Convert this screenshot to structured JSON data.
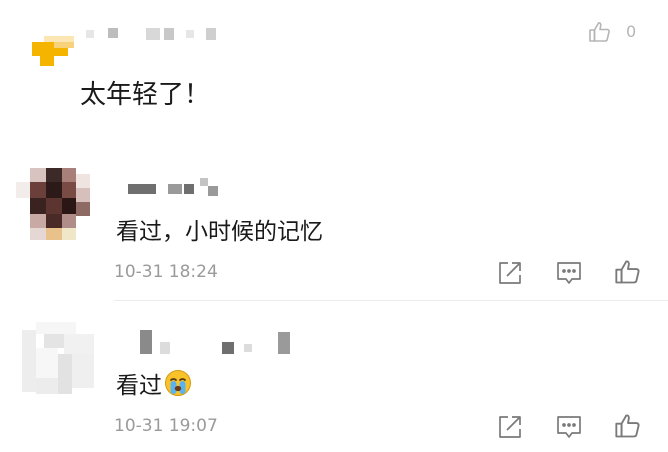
{
  "comments": [
    {
      "text": "太年轻了！",
      "like_count": "0"
    },
    {
      "text": "看过，小时候的记忆",
      "timestamp": "10-31 18:24"
    },
    {
      "text": "看过",
      "emoji": "crying-face",
      "timestamp": "10-31 19:07"
    }
  ],
  "icons": {
    "share": "share-icon",
    "reply": "comment-icon",
    "like": "thumbs-up-icon"
  },
  "colors": {
    "text": "#1a1a1a",
    "meta": "#9a9a9a",
    "icon": "#7a7a7a",
    "avatar_accent": "#f4b400"
  }
}
